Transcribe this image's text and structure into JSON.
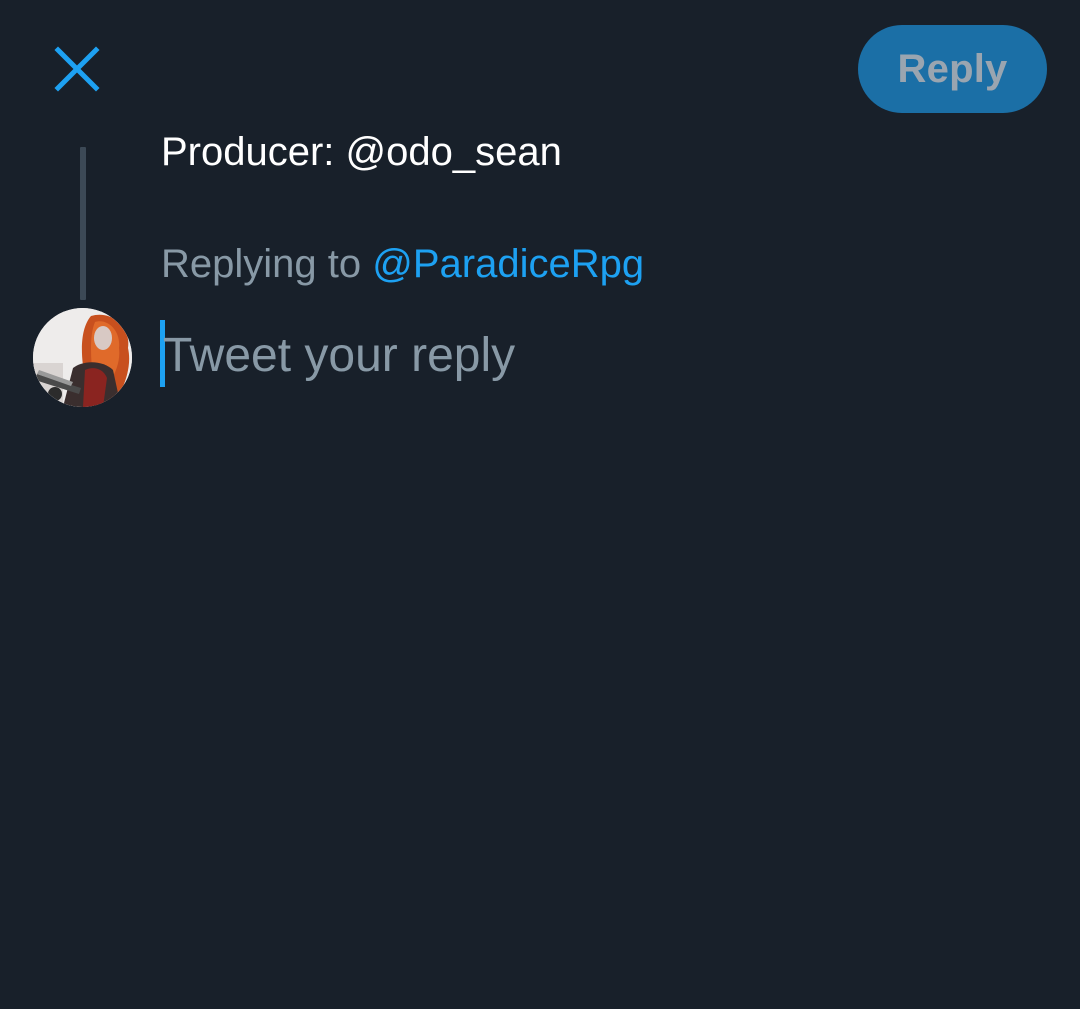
{
  "header": {
    "close_icon": "close-icon",
    "reply_button_label": "Reply"
  },
  "thread": {
    "quoted_tweet_text": "Producer: @odo_sean",
    "replying_to_prefix": "Replying to ",
    "replying_to_handle": "@ParadiceRpg"
  },
  "composer": {
    "avatar_icon": "user-avatar",
    "placeholder": "Tweet your reply",
    "value": ""
  },
  "colors": {
    "background": "#18202a",
    "accent": "#1da1f2",
    "reply_button_bg": "#1b6fa6",
    "muted_text": "#8899a6",
    "primary_text": "#ffffff"
  }
}
